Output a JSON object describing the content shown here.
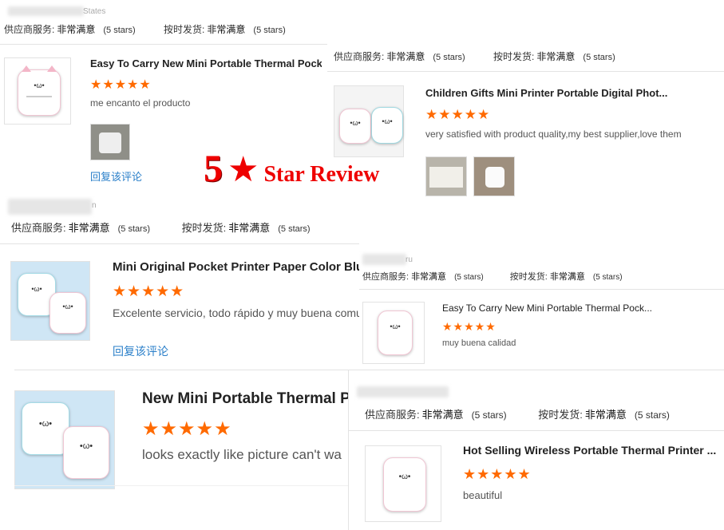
{
  "star_glyphs": "★★★★★",
  "common": {
    "supplier_label": "供应商服务:",
    "shipping_label": "按时发货:",
    "very_satisfied": "非常满意",
    "five_stars": "(5 stars)",
    "reply_label": "回复该评论"
  },
  "headline": {
    "number": "5",
    "text": "Star Review"
  },
  "cards": [
    {
      "country": "States",
      "title": "Easy To Carry New Mini Portable Thermal Pock...",
      "review": "me encanto el producto"
    },
    {
      "title": "Children Gifts Mini Printer Portable Digital Phot...",
      "review": "very satisfied with product quality,my best supplier,love them"
    },
    {
      "country": "n",
      "title": "Mini Original Pocket Printer Paper Color Blu",
      "review": "Excelente servicio, todo rápido y muy buena comur"
    },
    {
      "country": "ru",
      "title": "Easy To Carry New Mini Portable Thermal Pock...",
      "review": "muy buena calidad"
    },
    {
      "title": "New Mini Portable Thermal P",
      "review": "looks exactly like picture can't wa"
    },
    {
      "title": "Hot Selling Wireless Portable Thermal Printer ...",
      "review": "beautiful"
    }
  ]
}
